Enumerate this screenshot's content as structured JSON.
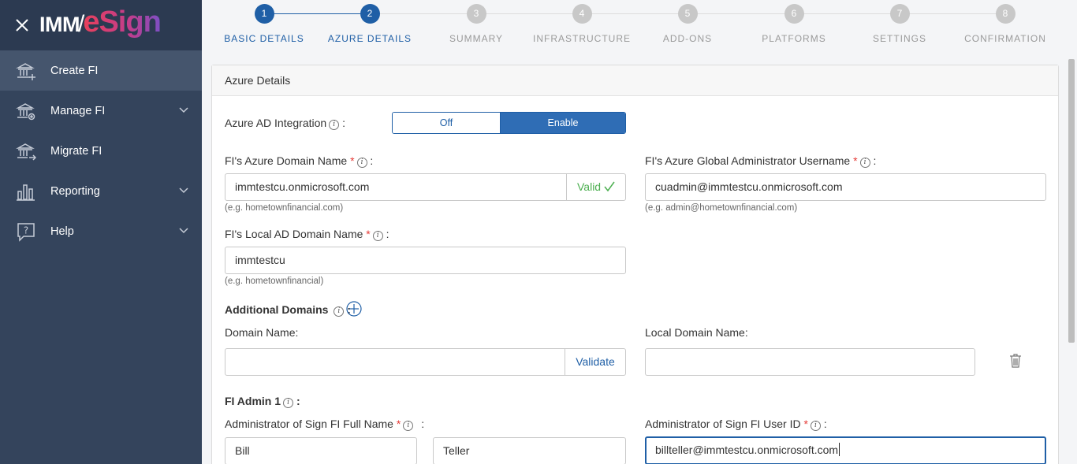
{
  "app": {
    "logo_left": "IMM",
    "logo_slash": "/",
    "logo_right": "eSign"
  },
  "sidebar": {
    "items": [
      {
        "label": "Create FI",
        "icon": "bank-add-icon",
        "active": true
      },
      {
        "label": "Manage FI",
        "icon": "bank-settings-icon",
        "expandable": true
      },
      {
        "label": "Migrate FI",
        "icon": "bank-migrate-icon"
      },
      {
        "label": "Reporting",
        "icon": "bar-chart-icon",
        "expandable": true
      },
      {
        "label": "Help",
        "icon": "help-icon",
        "expandable": true
      }
    ]
  },
  "stepper": {
    "steps": [
      {
        "number": "1",
        "label": "BASIC DETAILS",
        "state": "done"
      },
      {
        "number": "2",
        "label": "AZURE DETAILS",
        "state": "current"
      },
      {
        "number": "3",
        "label": "SUMMARY",
        "state": "todo"
      },
      {
        "number": "4",
        "label": "INFRASTRUCTURE",
        "state": "todo"
      },
      {
        "number": "5",
        "label": "ADD-ONS",
        "state": "todo"
      },
      {
        "number": "6",
        "label": "PLATFORMS",
        "state": "todo"
      },
      {
        "number": "7",
        "label": "SETTINGS",
        "state": "todo"
      },
      {
        "number": "8",
        "label": "CONFIRMATION",
        "state": "todo"
      }
    ]
  },
  "panel": {
    "title": "Azure Details",
    "ad_integration": {
      "label": "Azure AD Integration",
      "colon": ":",
      "off_label": "Off",
      "on_label": "Enable",
      "selected": "Enable"
    },
    "azure_domain": {
      "label": "FI's Azure Domain Name",
      "required": "*",
      "colon": ":",
      "value": "immtestcu.onmicrosoft.com",
      "status": "Valid",
      "hint": "(e.g. hometownfinancial.com)"
    },
    "global_admin": {
      "label": "FI's Azure Global Administrator Username",
      "required": "*",
      "colon": ":",
      "value": "cuadmin@immtestcu.onmicrosoft.com",
      "hint": "(e.g. admin@hometownfinancial.com)"
    },
    "local_ad_domain": {
      "label": "FI's Local AD Domain Name",
      "required": "*",
      "colon": ":",
      "value": "immtestcu",
      "hint": "(e.g. hometownfinancial)"
    },
    "additional_domains": {
      "label": "Additional Domains",
      "colon": ":",
      "domain_name_label": "Domain Name:",
      "domain_name_value": "",
      "validate_label": "Validate",
      "local_domain_label": "Local Domain Name:",
      "local_domain_value": ""
    },
    "fi_admin": {
      "label": "FI Admin 1",
      "colon": ":",
      "full_name_label": "Administrator of Sign FI Full Name",
      "full_name_required": "*",
      "full_name_colon": ":",
      "first_name": "Bill",
      "last_name": "Teller",
      "user_id_label": "Administrator of Sign FI User ID",
      "user_id_required": "*",
      "user_id_colon": ":",
      "user_id_value": "billteller@immtestcu.onmicrosoft.com"
    }
  },
  "colors": {
    "sidebar_bg": "#34445c",
    "sidebar_active": "#45556d",
    "primary": "#1f5fa6",
    "valid_green": "#4caf50",
    "required_red": "#e53935"
  }
}
